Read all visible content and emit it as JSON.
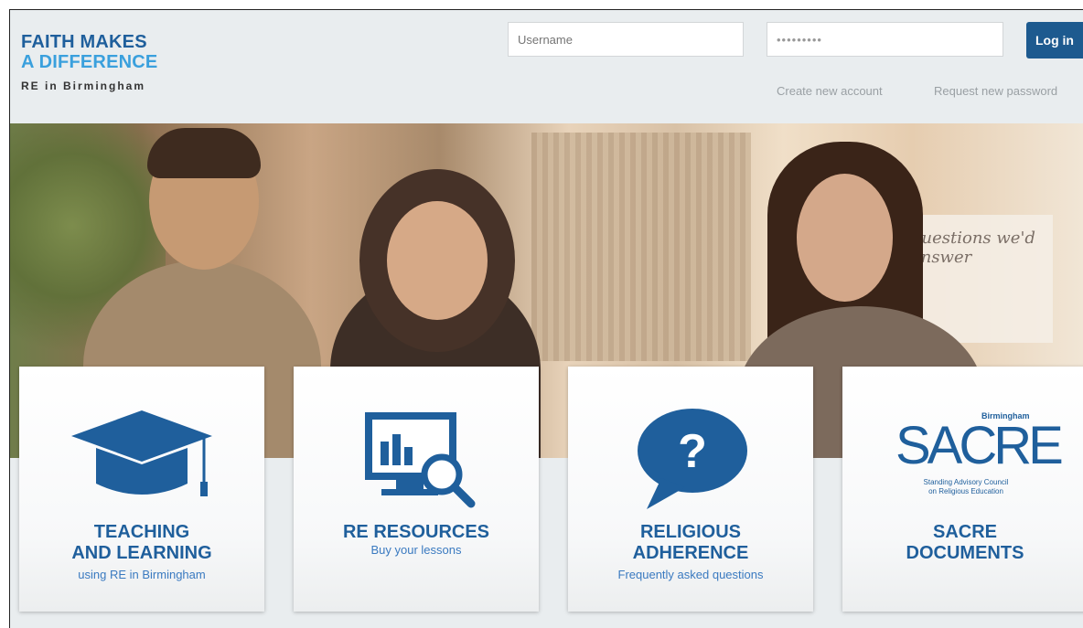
{
  "brand": {
    "line1": "FAITH MAKES",
    "line2": "A DIFFERENCE",
    "line3": "RE in Birmingham",
    "primary_color": "#1f5f9c",
    "accent_color": "#3aa0dd"
  },
  "login": {
    "username_placeholder": "Username",
    "password_value": "•••••••••",
    "login_label": "Log in",
    "create_account": "Create new account",
    "request_password": "Request new password"
  },
  "hero": {
    "board_text": "questions we'd answer",
    "prev_icon": "chevron-left-icon",
    "next_icon": "chevron-right-icon"
  },
  "cards": [
    {
      "title1": "TEACHING",
      "title2": "AND LEARNING",
      "subtitle": "using RE in Birmingham",
      "icon": "graduation-cap-icon"
    },
    {
      "title1": "RE RESOURCES",
      "title2": "",
      "subtitle": "Buy your lessons",
      "icon": "monitor-chart-search-icon"
    },
    {
      "title1": "RELIGIOUS",
      "title2": "ADHERENCE",
      "subtitle": "Frequently asked questions",
      "icon": "question-speech-bubble-icon"
    },
    {
      "title1": "SACRE",
      "title2": "DOCUMENTS",
      "subtitle": "",
      "icon": "sacre-logo-icon",
      "logo": {
        "small": "Birmingham",
        "big": "SACRE",
        "line1": "Standing Advisory Council",
        "line2": "on Religious Education"
      }
    }
  ]
}
